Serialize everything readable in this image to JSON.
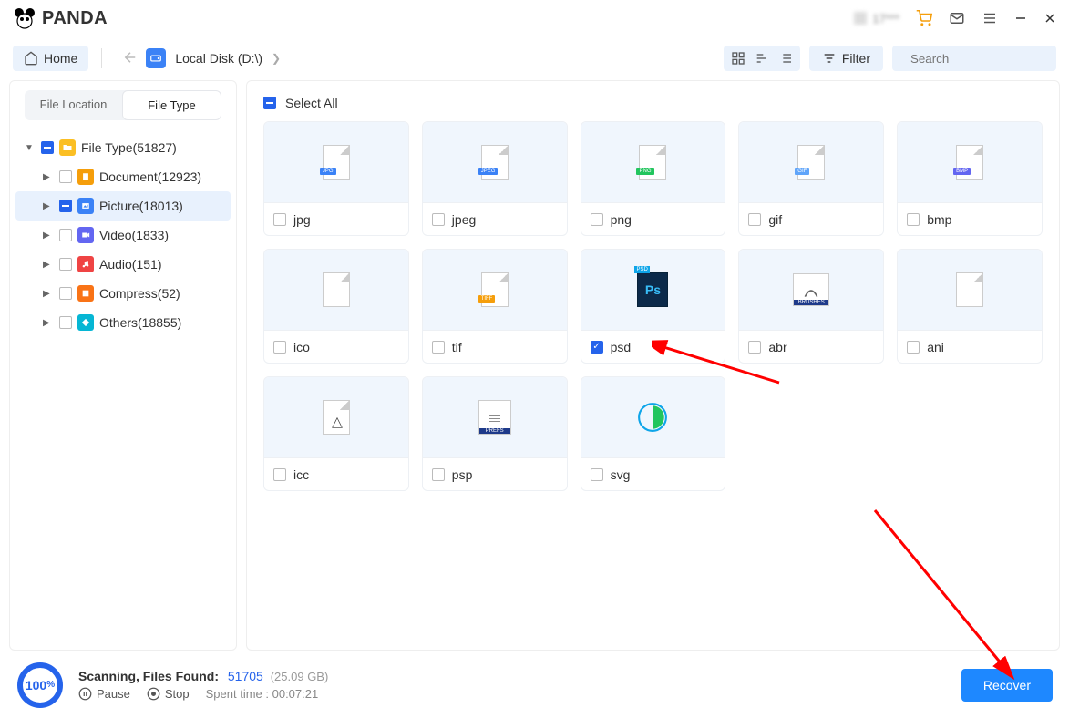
{
  "titlebar": {
    "brand": "PANDA",
    "user": "17***"
  },
  "toolbar": {
    "home_label": "Home",
    "breadcrumb": "Local Disk (D:\\)",
    "filter_label": "Filter",
    "search_placeholder": "Search"
  },
  "sidebar": {
    "tabs": {
      "file_location": "File Location",
      "file_type": "File Type"
    },
    "root_label": "File Type(51827)",
    "items": [
      {
        "label": "Document(12923)"
      },
      {
        "label": "Picture(18013)"
      },
      {
        "label": "Video(1833)"
      },
      {
        "label": "Audio(151)"
      },
      {
        "label": "Compress(52)"
      },
      {
        "label": "Others(18855)"
      }
    ]
  },
  "content": {
    "select_all_label": "Select All",
    "formats": [
      {
        "name": "jpg",
        "badge": "JPG",
        "badge_color": "#3b82f6",
        "checked": false
      },
      {
        "name": "jpeg",
        "badge": "JPEG",
        "badge_color": "#3b82f6",
        "checked": false
      },
      {
        "name": "png",
        "badge": "PNG",
        "badge_color": "#22c55e",
        "checked": false
      },
      {
        "name": "gif",
        "badge": "GIF",
        "badge_color": "#60a5fa",
        "checked": false
      },
      {
        "name": "bmp",
        "badge": "BMP",
        "badge_color": "#6366f1",
        "checked": false
      },
      {
        "name": "ico",
        "badge": "",
        "badge_color": "",
        "checked": false
      },
      {
        "name": "tif",
        "badge": "TIFF",
        "badge_color": "#f59e0b",
        "checked": false
      },
      {
        "name": "psd",
        "badge": "PSD",
        "badge_color": "#0c4a6e",
        "checked": true
      },
      {
        "name": "abr",
        "badge": "BRUSHES",
        "badge_color": "#1e3a8a",
        "checked": false
      },
      {
        "name": "ani",
        "badge": "",
        "badge_color": "",
        "checked": false
      },
      {
        "name": "icc",
        "badge": "",
        "badge_color": "",
        "checked": false
      },
      {
        "name": "psp",
        "badge": "PREFS",
        "badge_color": "#1e3a8a",
        "checked": false
      },
      {
        "name": "svg",
        "badge": "",
        "badge_color": "",
        "checked": false
      }
    ]
  },
  "status": {
    "progress_pct": "100",
    "progress_suffix": "%",
    "scanning_label": "Scanning, Files Found:",
    "found_count": "51705",
    "found_size": "(25.09 GB)",
    "pause_label": "Pause",
    "stop_label": "Stop",
    "spent_label": "Spent time : 00:07:21",
    "recover_label": "Recover"
  }
}
